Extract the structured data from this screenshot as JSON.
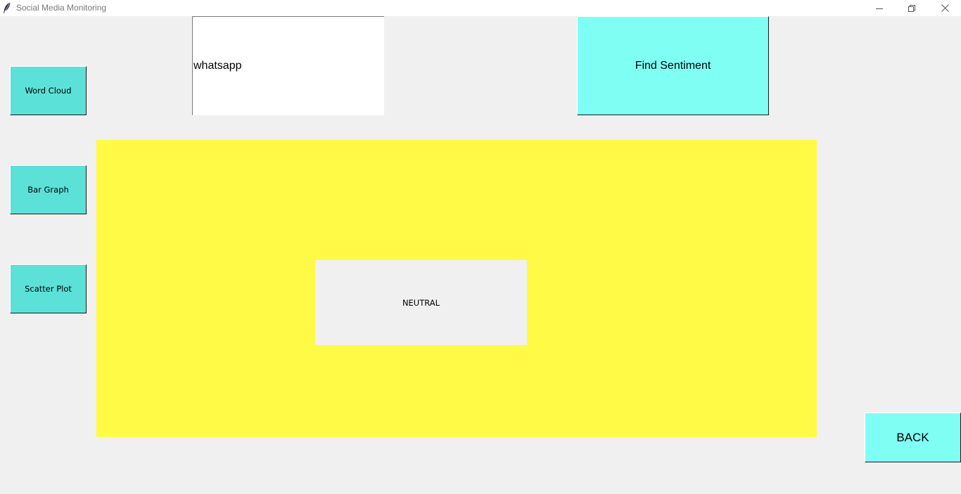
{
  "window": {
    "title": "Social Media Monitoring",
    "icon": "feather-icon"
  },
  "sidebar": {
    "items": [
      {
        "label": "Word Cloud"
      },
      {
        "label": "Bar Graph"
      },
      {
        "label": "Scatter Plot"
      }
    ]
  },
  "search": {
    "value": "whatsapp"
  },
  "actions": {
    "find_label": "Find Sentiment",
    "back_label": "BACK"
  },
  "result": {
    "sentiment": "NEUTRAL"
  },
  "colors": {
    "side_button": "#5ce1d8",
    "action_button": "#7ffff4",
    "result_panel": "#fffa46",
    "background": "#f0f0f0"
  }
}
